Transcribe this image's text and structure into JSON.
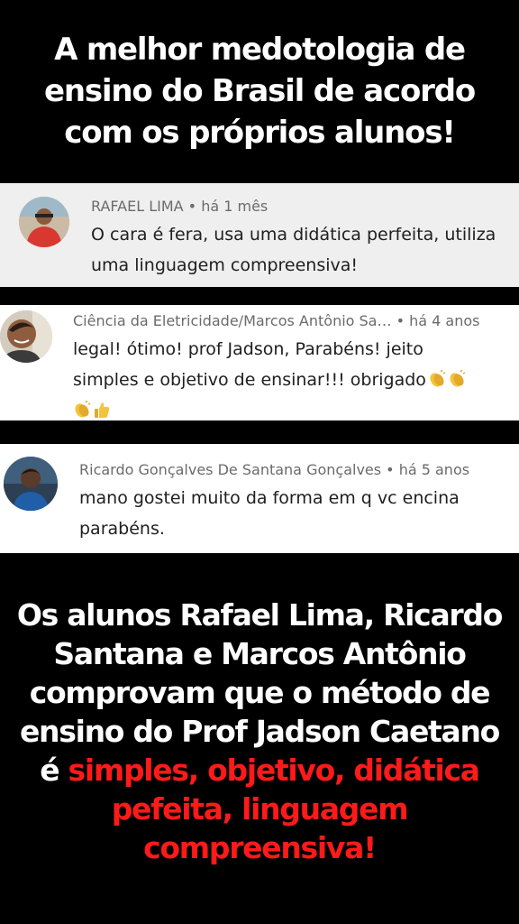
{
  "headline": {
    "line1": "A melhor medotologia de",
    "line2": "ensino do Brasil de acordo",
    "line3": "com os próprios alunos!"
  },
  "comments": [
    {
      "author": "RAFAEL LIMA",
      "meta": "RAFAEL LIMA • há 1 mês",
      "line1": "O cara é fera, usa uma didática perfeita, utiliza",
      "line2": "uma linguagem compreensiva!"
    },
    {
      "author": "Ciência da Eletricidade/Marcos Antônio Sa…",
      "meta": "Ciência da Eletricidade/Marcos Antônio Sa…  • há 4 anos",
      "line1": "legal! ótimo! prof Jadson, Parabéns! jeito",
      "line2": "simples e objetivo de ensinar!!! obrigado",
      "emoji_line3": [
        "clapping-hands",
        "thumbs-up"
      ],
      "emoji_line2": [
        "clapping-hands",
        "clapping-hands"
      ]
    },
    {
      "author": "Ricardo Gonçalves De Santana Gonçalves",
      "meta": "Ricardo Gonçalves De Santana Gonçalves • há 5 anos",
      "line1": "mano gostei muito da forma em q vc encina",
      "line2": "parabéns."
    }
  ],
  "summary": {
    "line1": "Os alunos Rafael Lima, Ricardo",
    "line2": "Santana e Marcos Antônio",
    "line3": "comprovam que o método de",
    "line4": "ensino do Prof Jadson Caetano",
    "line5_prefix": "é ",
    "line5_highlight": "simples, objetivo, didática",
    "line6": "pefeita, linguagem",
    "line7": "compreensiva!"
  },
  "colors": {
    "background": "#000000",
    "headline": "#ffffff",
    "highlight": "#ff1a1a",
    "comment_bg_1": "#efefef",
    "comment_bg": "#ffffff",
    "meta_text": "#6b6b6b"
  }
}
